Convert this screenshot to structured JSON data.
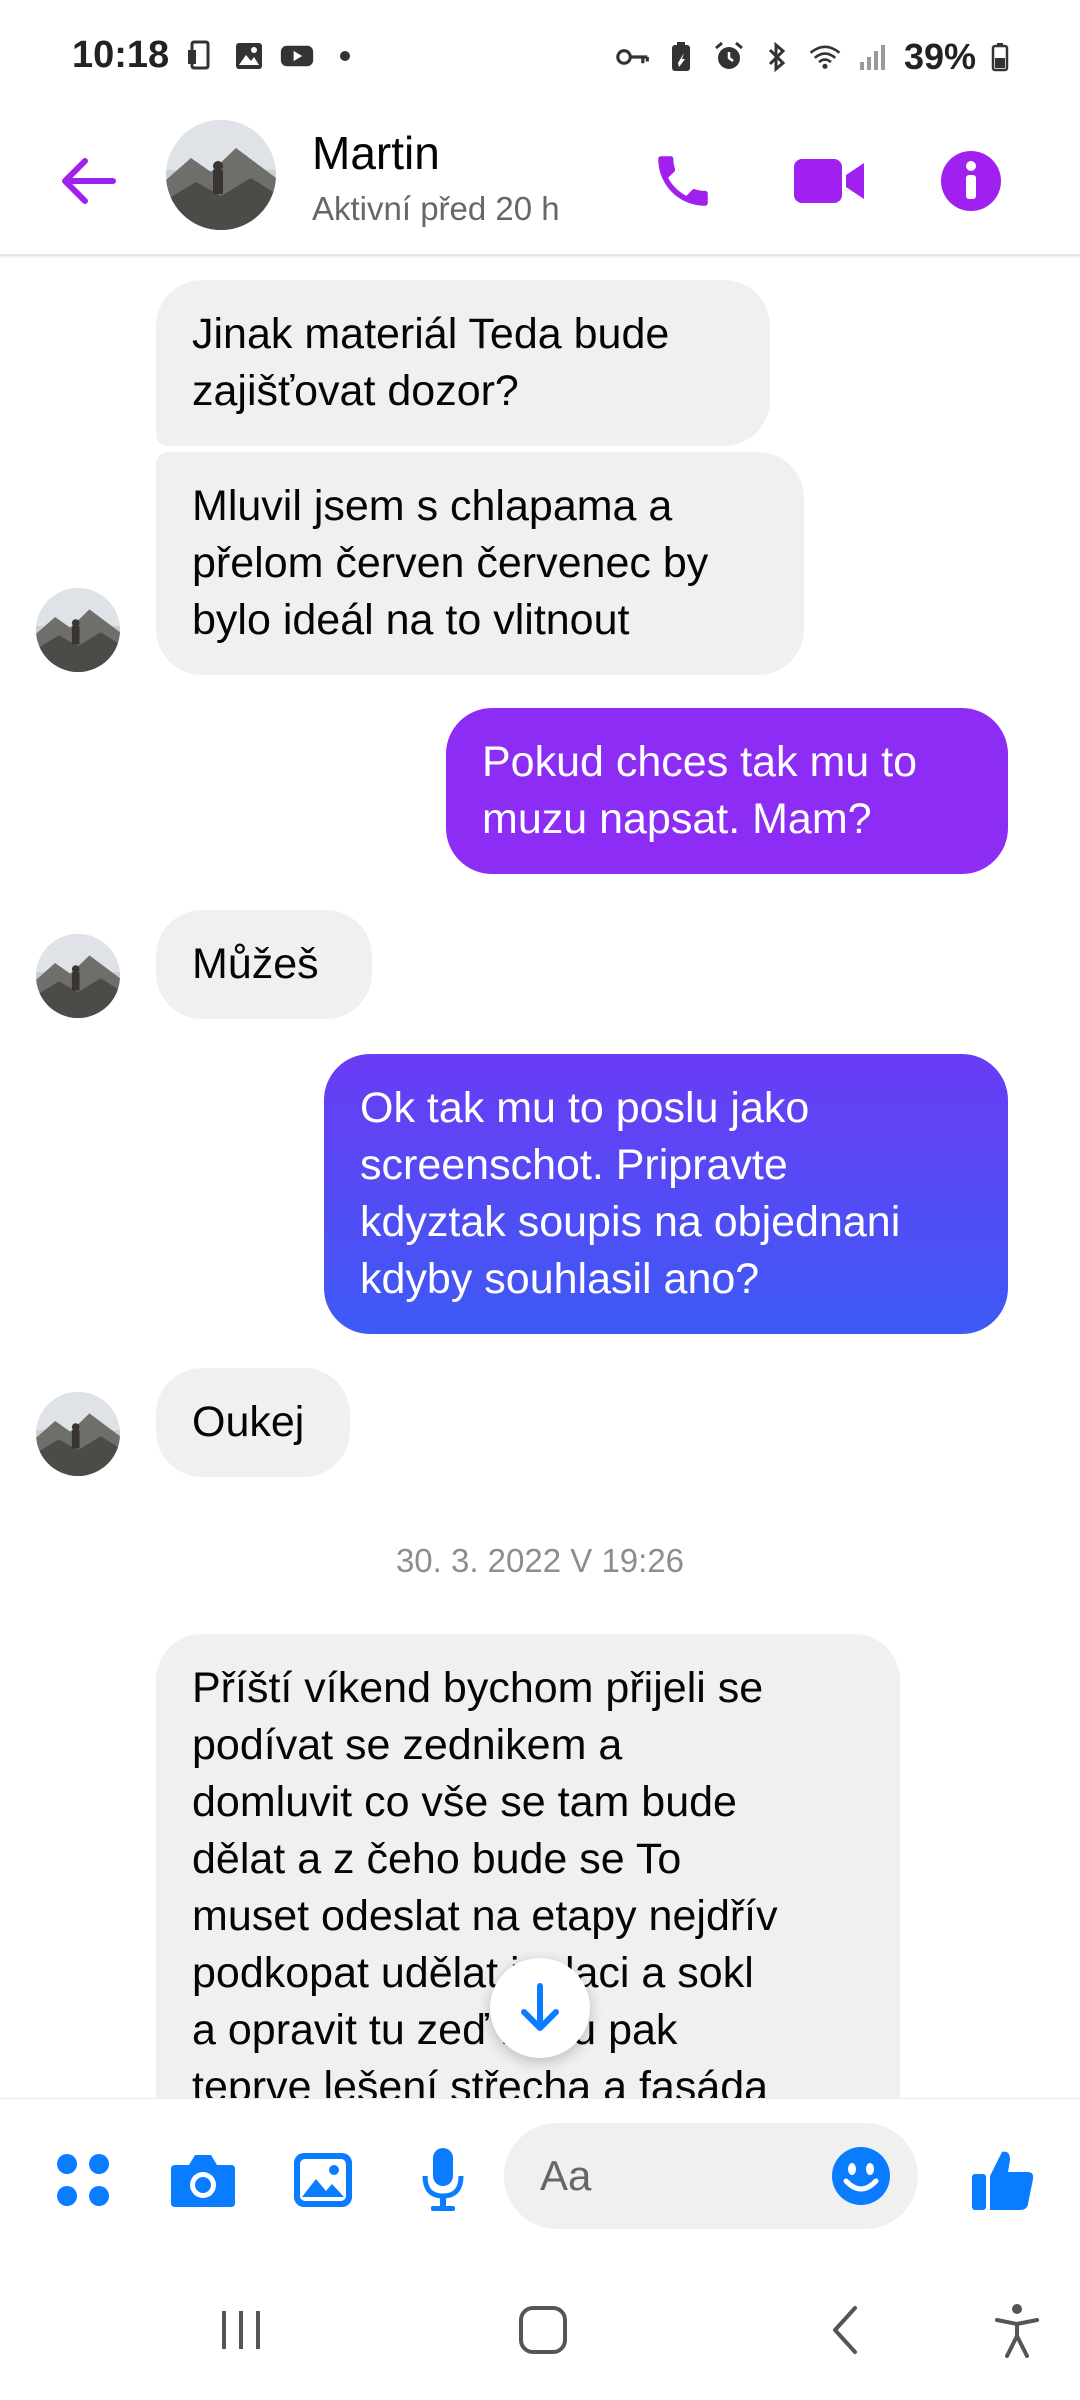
{
  "status_bar": {
    "time": "10:18",
    "battery": "39%",
    "icons_left": [
      "phone-screen-icon",
      "gallery-icon",
      "youtube-icon",
      "dot-icon"
    ],
    "icons_right": [
      "vpn-key-icon",
      "battery-saver-icon",
      "alarm-icon",
      "bluetooth-icon",
      "wifi-icon",
      "signal-icon",
      "battery-icon"
    ]
  },
  "header": {
    "name": "Martin",
    "status": "Aktivní před 20 h"
  },
  "messages": [
    {
      "side": "in",
      "text": "Jinak materiál Teda bude\nzajišťovat dozor?"
    },
    {
      "side": "in",
      "text": "Mluvil jsem s chlapama a\npřelom červen červenec by\nbylo ideál na to vlitnout"
    },
    {
      "side": "out",
      "text": "Pokud chces tak mu to\nmuzu napsat. Mam?"
    },
    {
      "side": "in",
      "text": "Můžeš"
    },
    {
      "side": "out",
      "text": "Ok tak mu to poslu jako\nscreenschot. Pripravte\nkdyztak soupis na objednani\nkdyby souhlasil ano?"
    },
    {
      "side": "in",
      "text": "Oukej"
    },
    {
      "side": "in",
      "text": "Příští víkend bychom přijeli se\npodívat se zednikem a\ndomluvit co vše se tam bude\ndělat  a z čeho bude se To\nmuset odeslat na etapy nejdřív\npodkopat udělat izolaci a sokl\na opravit tu zeď nohu pak\nteprve lešení střecha a fasáda"
    }
  ],
  "timestamp": "30. 3. 2022 V 19:26",
  "composer": {
    "placeholder": "Aa"
  },
  "colors": {
    "accent": "#a020f0",
    "messenger_blue": "#0a7cff",
    "outgoing_top": "#8f2bf5",
    "outgoing_bottom": "#3d5af5",
    "incoming": "#f0f0f0"
  }
}
